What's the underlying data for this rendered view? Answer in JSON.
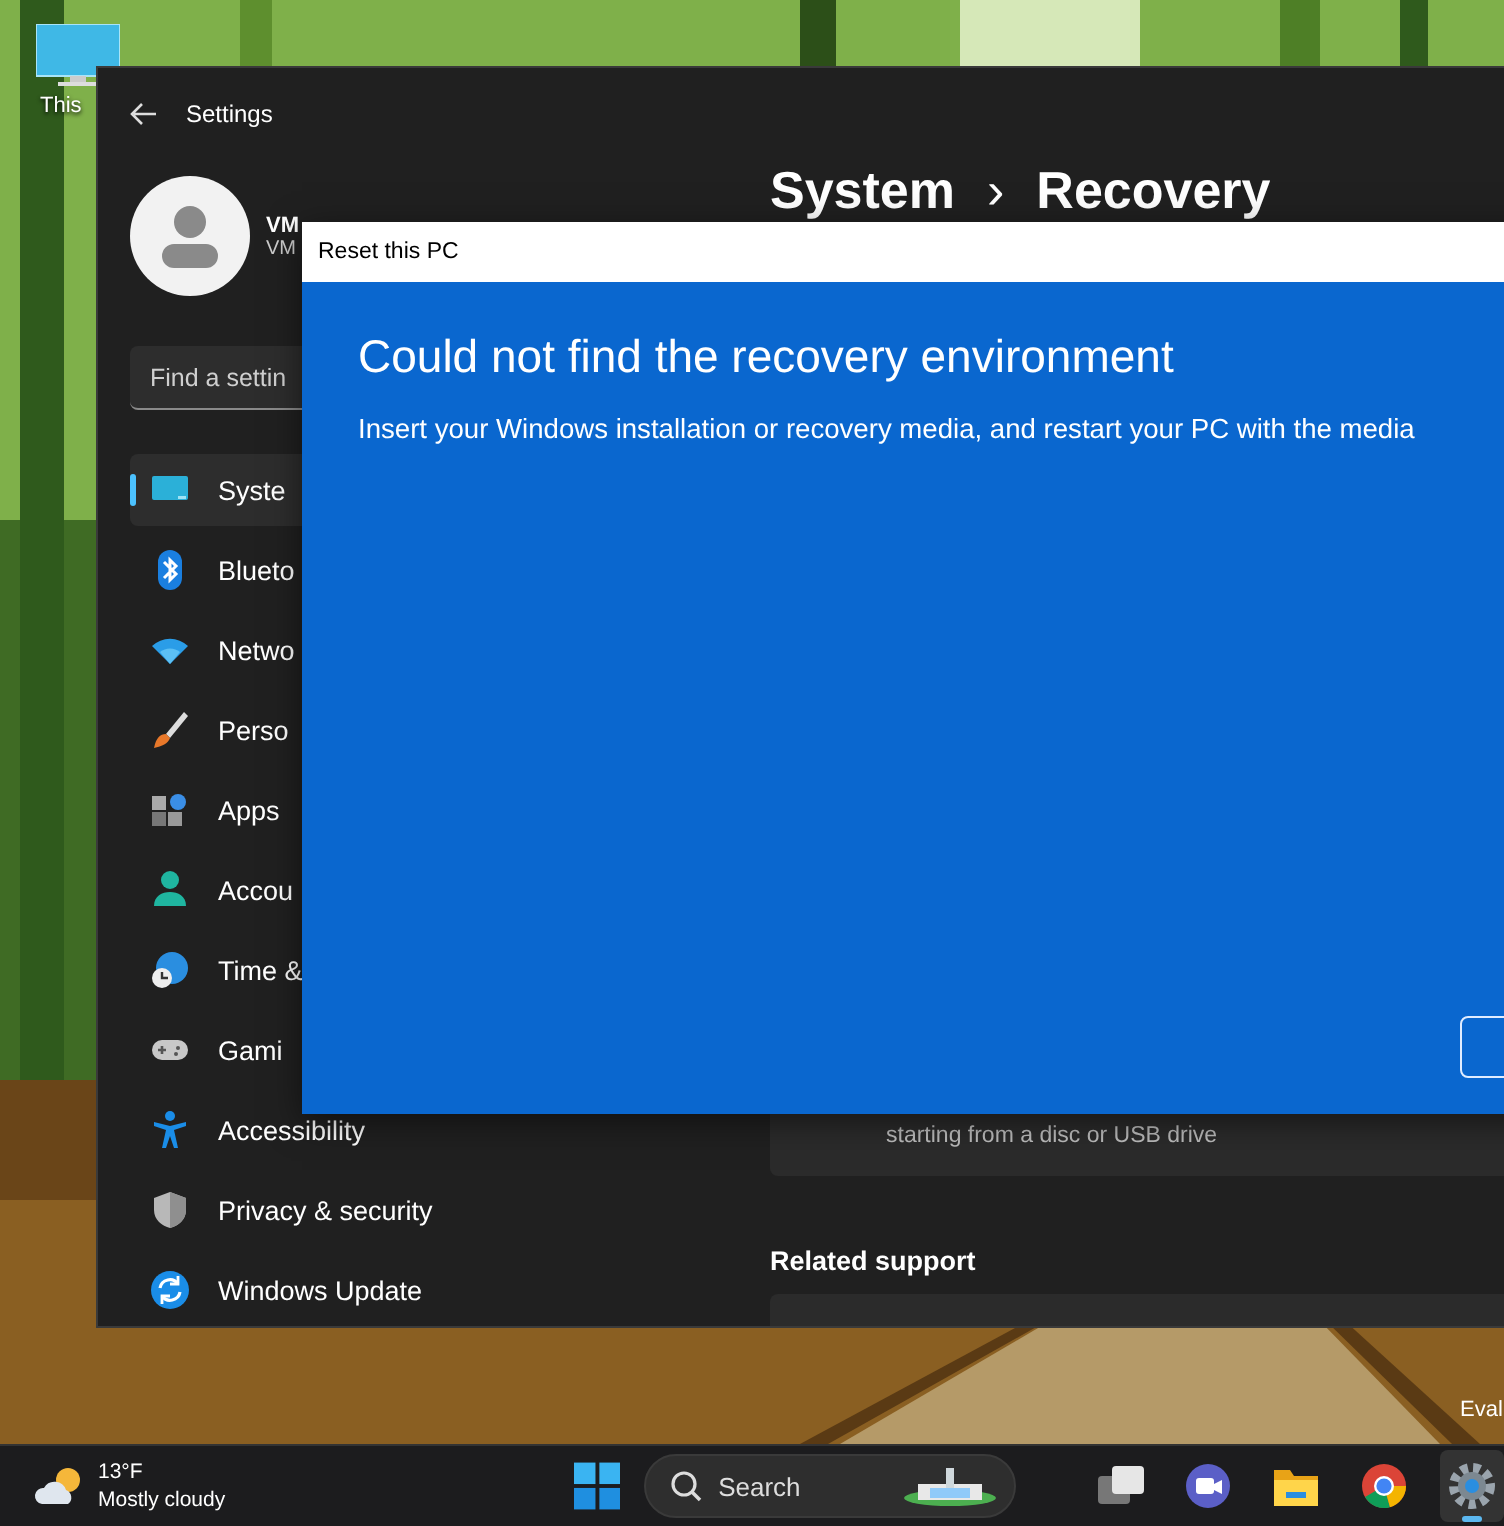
{
  "desktop": {
    "icons": [
      {
        "label": "This"
      }
    ],
    "notice": "Eval"
  },
  "settings": {
    "title": "Settings",
    "account": {
      "name": "VM",
      "subtitle": "VM"
    },
    "search": {
      "placeholder": "Find a settin"
    },
    "breadcrumb": [
      "System",
      "›",
      "Recovery"
    ],
    "nav": [
      {
        "kind": "system",
        "label": "Syste",
        "selected": true
      },
      {
        "kind": "bluetooth",
        "label": "Blueto",
        "selected": false
      },
      {
        "kind": "network",
        "label": "Netwo",
        "selected": false
      },
      {
        "kind": "personalization",
        "label": "Perso",
        "selected": false
      },
      {
        "kind": "apps",
        "label": "Apps",
        "selected": false
      },
      {
        "kind": "accounts",
        "label": "Accou",
        "selected": false
      },
      {
        "kind": "time",
        "label": "Time &",
        "selected": false
      },
      {
        "kind": "gaming",
        "label": "Gami",
        "selected": false
      },
      {
        "kind": "accessibility",
        "label": "Accessibility",
        "selected": false
      },
      {
        "kind": "privacy",
        "label": "Privacy & security",
        "selected": false
      },
      {
        "kind": "update",
        "label": "Windows Update",
        "selected": false
      }
    ],
    "recovery_card": {
      "description": "starting from a disc or USB drive"
    },
    "related_support": {
      "heading": "Related support"
    }
  },
  "dialog": {
    "title": "Reset this PC",
    "heading": "Could not find the recovery environment",
    "message": "Insert your Windows installation or recovery media, and restart your PC with the media"
  },
  "taskbar": {
    "weather": {
      "temperature": "13°F",
      "condition": "Mostly cloudy"
    },
    "search": {
      "placeholder": "Search"
    },
    "apps": [
      {
        "kind": "task-view",
        "selected": false
      },
      {
        "kind": "meet",
        "selected": false
      },
      {
        "kind": "file-explorer",
        "selected": false
      },
      {
        "kind": "browser",
        "selected": false
      },
      {
        "kind": "settings",
        "selected": true
      }
    ]
  }
}
